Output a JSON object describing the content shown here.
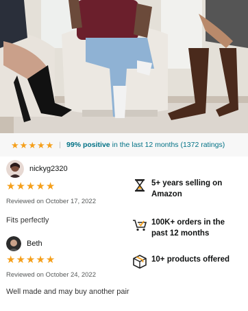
{
  "hero": {
    "description_icon": "product-photo-compression-socks"
  },
  "rating_bar": {
    "stars": 5,
    "positive_percent": "99% positive",
    "rest": "in the last 12 months (1372 ratings)"
  },
  "reviews": [
    {
      "name": "nickyg2320",
      "stars": 5,
      "date": "Reviewed on October 17, 2022",
      "text": "Fits perfectly"
    },
    {
      "name": "Beth",
      "stars": 5,
      "date": "Reviewed on October 24, 2022",
      "text": "Well made and may buy another pair"
    }
  ],
  "features": [
    {
      "icon": "hourglass-icon",
      "text": "5+ years selling on Amazon"
    },
    {
      "icon": "cart-check-icon",
      "text": "100K+ orders in the past 12 months"
    },
    {
      "icon": "box-icon",
      "text": "10+ products offered"
    }
  ],
  "colors": {
    "star": "#f59f1a",
    "link": "#007185"
  }
}
